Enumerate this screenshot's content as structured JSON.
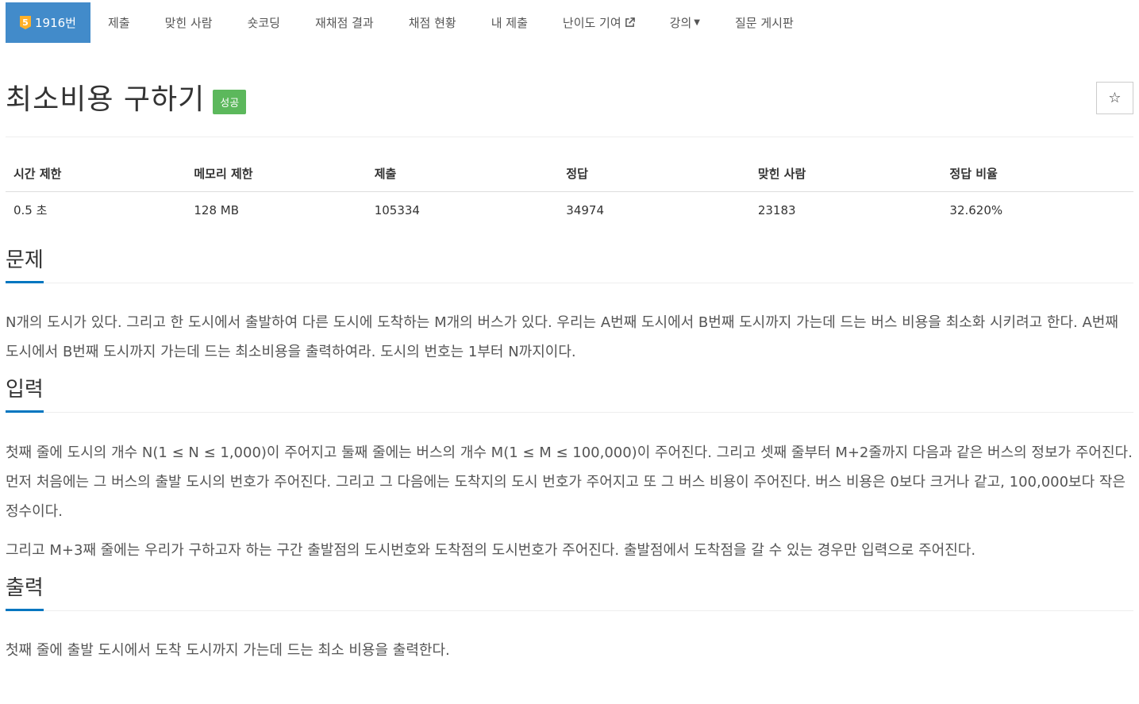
{
  "tabs": [
    {
      "label": "1916번",
      "tier": "5",
      "active": true
    },
    {
      "label": "제출"
    },
    {
      "label": "맞힌 사람"
    },
    {
      "label": "숏코딩"
    },
    {
      "label": "재채점 결과"
    },
    {
      "label": "채점 현황"
    },
    {
      "label": "내 제출"
    },
    {
      "label": "난이도 기여"
    },
    {
      "label": "강의"
    },
    {
      "label": "질문 게시판"
    }
  ],
  "problem": {
    "title": "최소비용 구하기",
    "badge": "성공",
    "star": "☆"
  },
  "stats": {
    "headers": [
      "시간 제한",
      "메모리 제한",
      "제출",
      "정답",
      "맞힌 사람",
      "정답 비율"
    ],
    "values": [
      "0.5 초",
      "128 MB",
      "105334",
      "34974",
      "23183",
      "32.620%"
    ]
  },
  "sections": {
    "description": {
      "title": "문제",
      "paragraphs": [
        "N개의 도시가 있다. 그리고 한 도시에서 출발하여 다른 도시에 도착하는 M개의 버스가 있다. 우리는 A번째 도시에서 B번째 도시까지 가는데 드는 버스 비용을 최소화 시키려고 한다. A번째 도시에서 B번째 도시까지 가는데 드는 최소비용을 출력하여라. 도시의 번호는 1부터 N까지이다."
      ]
    },
    "input": {
      "title": "입력",
      "paragraphs": [
        "첫째 줄에 도시의 개수 N(1 ≤ N ≤ 1,000)이 주어지고 둘째 줄에는 버스의 개수 M(1 ≤ M ≤ 100,000)이 주어진다. 그리고 셋째 줄부터 M+2줄까지 다음과 같은 버스의 정보가 주어진다. 먼저 처음에는 그 버스의 출발 도시의 번호가 주어진다. 그리고 그 다음에는 도착지의 도시 번호가 주어지고 또 그 버스 비용이 주어진다. 버스 비용은 0보다 크거나 같고, 100,000보다 작은 정수이다.",
        "그리고 M+3째 줄에는 우리가 구하고자 하는 구간 출발점의 도시번호와 도착점의 도시번호가 주어진다. 출발점에서 도착점을 갈 수 있는 경우만 입력으로 주어진다."
      ]
    },
    "output": {
      "title": "출력",
      "paragraphs": [
        "첫째 줄에 출발 도시에서 도착 도시까지 가는데 드는 최소 비용을 출력한다."
      ]
    }
  },
  "colors": {
    "active_tab": "#428bca",
    "success_badge": "#5cb85c",
    "tier_badge": "#ffb028",
    "section_underline": "#0076c0"
  }
}
